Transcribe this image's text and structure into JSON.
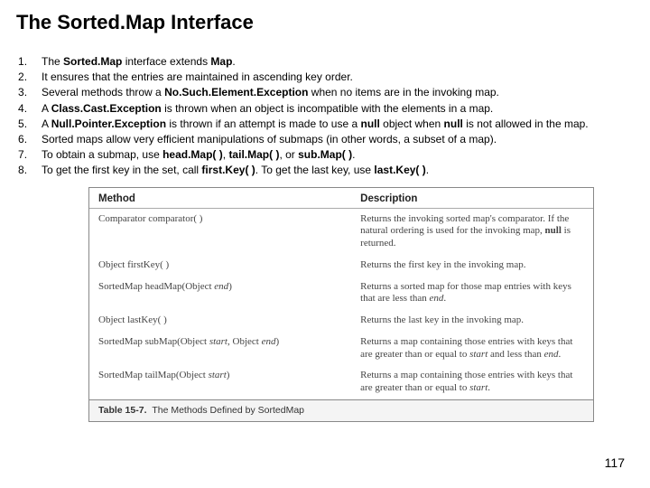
{
  "title": "The Sorted.Map Interface",
  "points": [
    "The <b>Sorted.Map </b>interface extends <b>Map</b>.",
    "It ensures that the entries are maintained in ascending key order.",
    "Several methods throw a <b>No.Such.Element.Exception </b>when no items are in the invoking map.",
    "A <b>Class.Cast.Exception </b>is thrown when an object is incompatible with the elements in a map.",
    "A <b>Null.Pointer.Exception </b>is thrown if an attempt is made to use a <b>null </b>object when <b>null </b>is not allowed in the map.",
    "Sorted maps allow very efficient manipulations of submaps (in other words, a subset of a map).",
    "To obtain a submap, use <b>head.Map( )</b>, <b>tail.Map( )</b>, or <b>sub.Map( )</b>.",
    "To get the first key in the set, call <b>first.Key( )</b>. To get the last key, use <b>last.Key( )</b>."
  ],
  "table": {
    "headers": [
      "Method",
      "Description"
    ],
    "rows": [
      {
        "method": "Comparator comparator( )",
        "desc": "Returns the invoking sorted map's comparator. If the natural ordering is used for the invoking map, <b>null</b> is returned."
      },
      {
        "method": "Object firstKey( )",
        "desc": "Returns the first key in the invoking map."
      },
      {
        "method": "SortedMap headMap(Object <i>end</i>)",
        "desc": "Returns a sorted map for those map entries with keys that are less than <i>end</i>."
      },
      {
        "method": "Object lastKey( )",
        "desc": "Returns the last key in the invoking map."
      },
      {
        "method": "SortedMap subMap(Object <i>start</i>, Object <i>end</i>)",
        "desc": "Returns a map containing those entries with keys that are greater than or equal to <i>start</i> and less than <i>end</i>."
      },
      {
        "method": "SortedMap tailMap(Object <i>start</i>)",
        "desc": "Returns a map containing those entries with keys that are greater than or equal to <i>start</i>."
      }
    ],
    "caption": "<b>Table 15-7.</b>&nbsp;&nbsp;The Methods Defined by SortedMap"
  },
  "page": "117"
}
